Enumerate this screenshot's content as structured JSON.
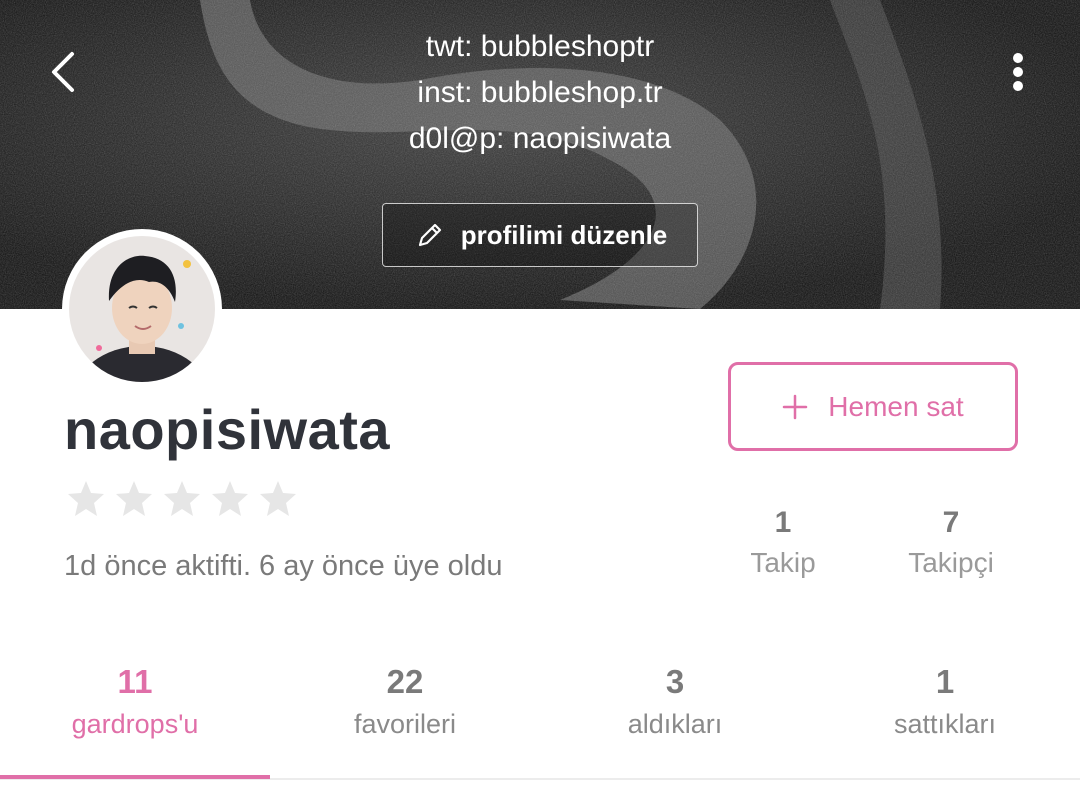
{
  "header": {
    "bio_lines": [
      "twt: bubbleshoptr",
      "inst: bubbleshop.tr",
      "d0l@p: naopisiwata"
    ],
    "edit_profile_label": "profilimi düzenle"
  },
  "profile": {
    "username": "naopisiwata",
    "rating_stars": 0,
    "rating_max": 5,
    "activity_text": "1d önce aktifti. 6 ay önce üye oldu"
  },
  "actions": {
    "sell_label": "Hemen sat"
  },
  "follow": {
    "following_count": "1",
    "following_label": "Takip",
    "followers_count": "7",
    "followers_label": "Takipçi"
  },
  "tabs": [
    {
      "count": "11",
      "label": "gardrops'u",
      "active": true
    },
    {
      "count": "22",
      "label": "favorileri",
      "active": false
    },
    {
      "count": "3",
      "label": "aldıkları",
      "active": false
    },
    {
      "count": "1",
      "label": "sattıkları",
      "active": false
    }
  ],
  "colors": {
    "accent": "#e06fa8",
    "text_dark": "#30333a",
    "text_muted": "#7a7a7a",
    "star_empty": "#e6e6e6"
  },
  "icons": {
    "back": "chevron-left-icon",
    "more": "more-vertical-icon",
    "edit": "pencil-icon",
    "add": "plus-icon",
    "rating": "star-icon"
  }
}
